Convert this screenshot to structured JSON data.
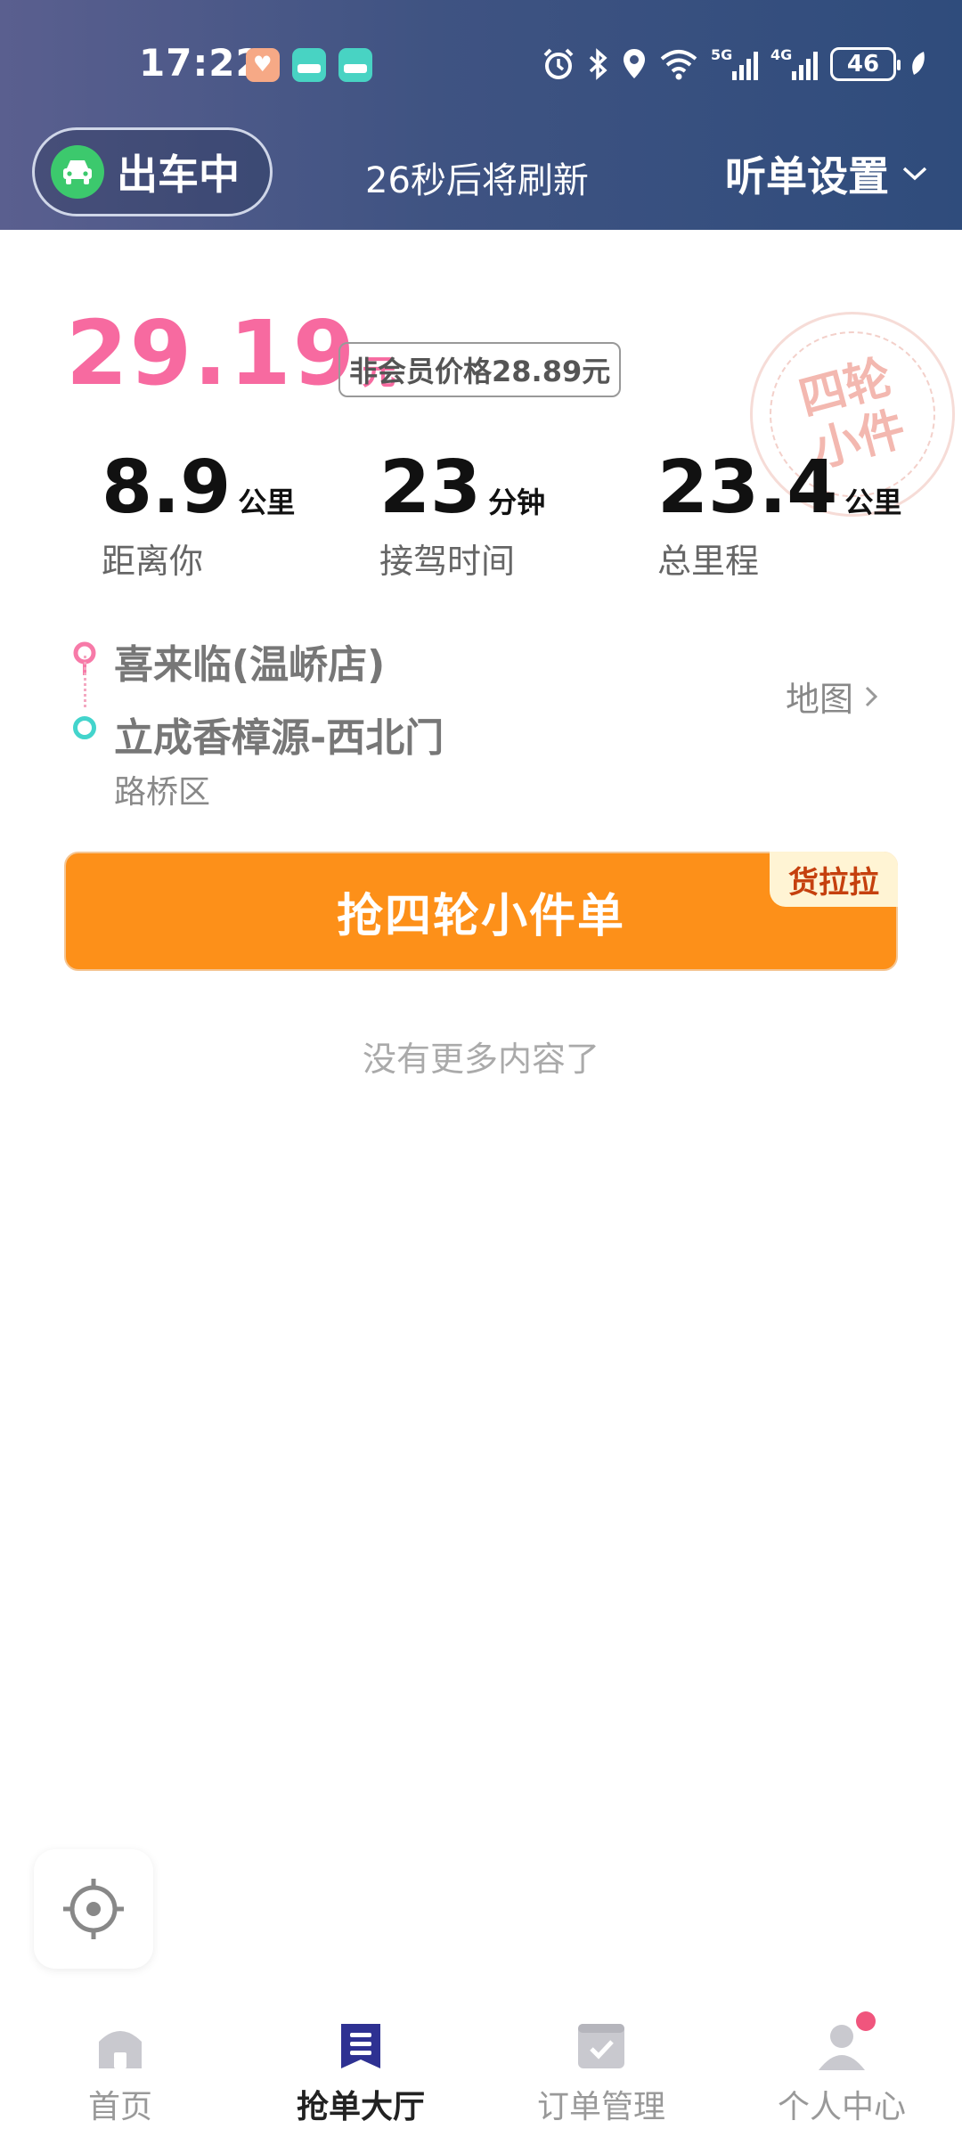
{
  "status_bar": {
    "time": "17:22",
    "battery": "46",
    "signal_1_label": "5G",
    "signal_2_label": "4G"
  },
  "toolbar": {
    "driving_label": "出车中",
    "refresh_text": "26秒后将刷新",
    "settings_label": "听单设置"
  },
  "order": {
    "price": "29.19",
    "price_unit": "元",
    "non_member_price": "非会员价格28.89元",
    "stamp_text": "四轮小件",
    "stats": [
      {
        "value": "8.9",
        "unit": "公里",
        "label": "距离你"
      },
      {
        "value": "23",
        "unit": "分钟",
        "label": "接驾时间"
      },
      {
        "value": "23.4",
        "unit": "公里",
        "label": "总里程"
      }
    ],
    "route": {
      "from": "喜来临(温峤店)",
      "to": "立成香樟源-西北门",
      "district": "路桥区",
      "map_link": "地图"
    },
    "grab_button": "抢四轮小件单",
    "brand_tag": "货拉拉"
  },
  "no_more_text": "没有更多内容了",
  "tabs": [
    {
      "label": "首页",
      "icon": "home-icon",
      "active": false
    },
    {
      "label": "抢单大厅",
      "icon": "order-hall-icon",
      "active": true
    },
    {
      "label": "订单管理",
      "icon": "order-manage-icon",
      "active": false
    },
    {
      "label": "个人中心",
      "icon": "profile-icon",
      "active": false
    }
  ],
  "colors": {
    "header_gradient_start": "#5a5f8f",
    "header_gradient_end": "#2f4c7c",
    "price": "#f76aa0",
    "grab_button": "#fd9019",
    "active_tab_icon": "#2e3192",
    "driving_icon": "#3cc96d"
  }
}
